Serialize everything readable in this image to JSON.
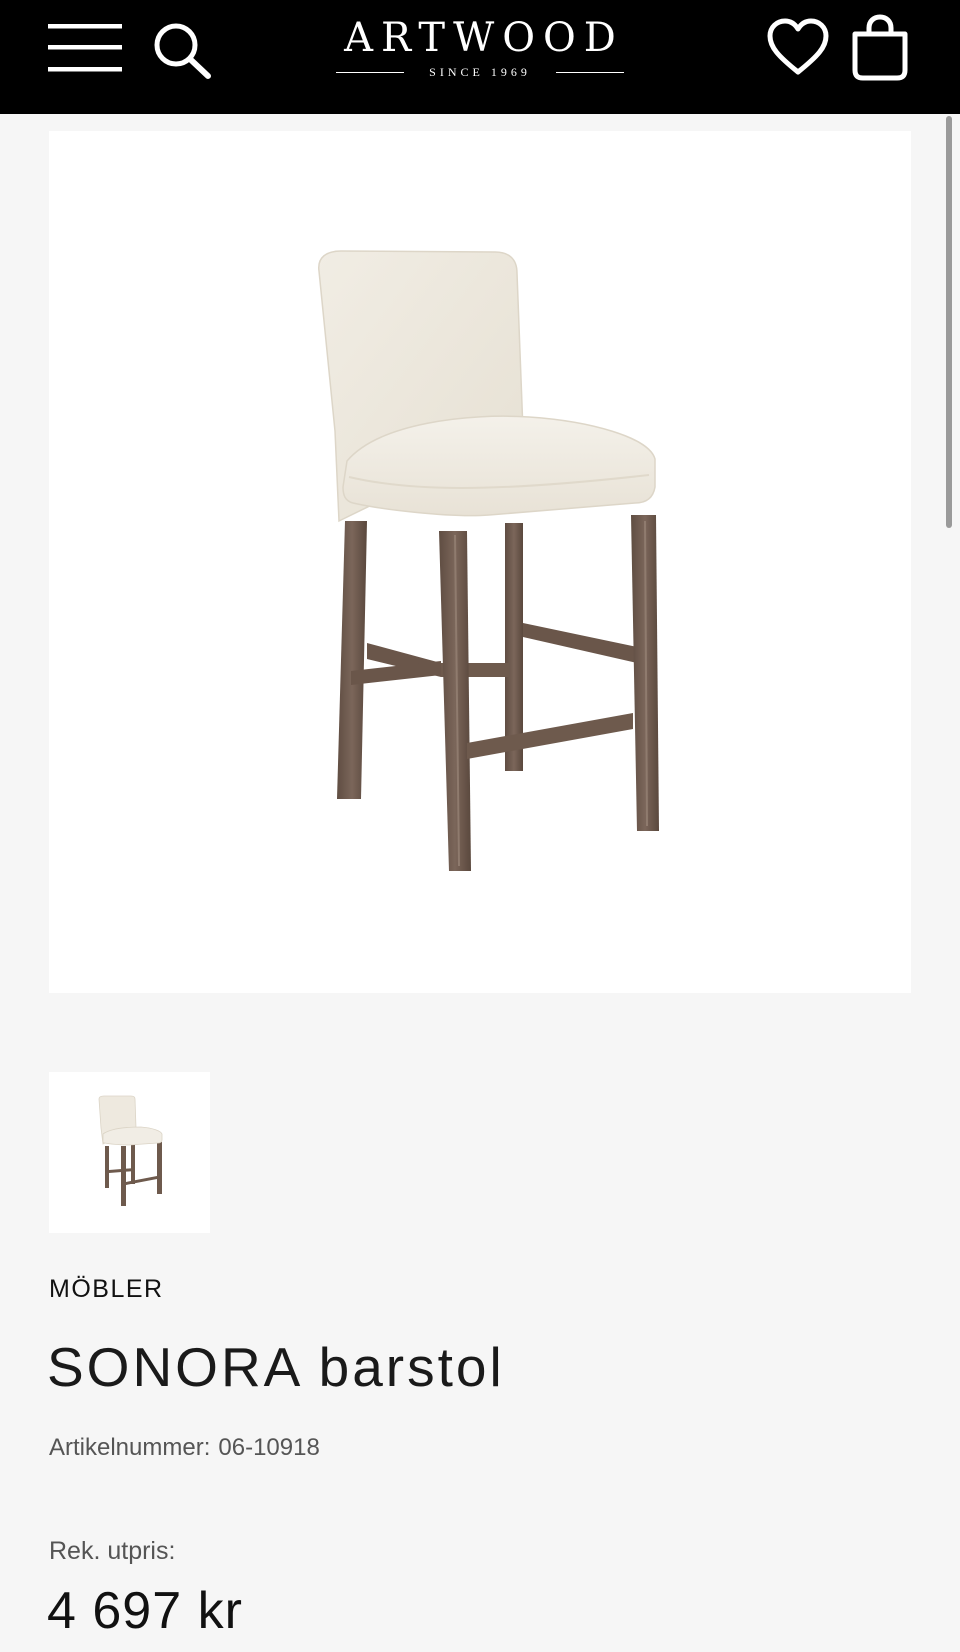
{
  "header": {
    "brand_name": "ARTWOOD",
    "brand_tagline": "SINCE 1969",
    "icons": {
      "menu": "hamburger-menu-icon",
      "search": "search-icon",
      "wishlist": "heart-icon",
      "cart": "shopping-bag-icon"
    },
    "colors": {
      "background": "#000000",
      "foreground": "#ffffff"
    }
  },
  "gallery": {
    "main_image": "upholstered-bar-stool-photo",
    "thumbnails": [
      "upholstered-bar-stool-thumbnail"
    ]
  },
  "product": {
    "category": "MÖBLER",
    "title": "SONORA barstol",
    "sku_label": "Artikelnummer:",
    "sku_value": "06-10918",
    "price_label": "Rek. utpris:",
    "price": "4 697 kr"
  },
  "colors": {
    "page_background": "#f6f6f6",
    "upholstery": "#efeae0",
    "wood": "#6e5a4d"
  }
}
